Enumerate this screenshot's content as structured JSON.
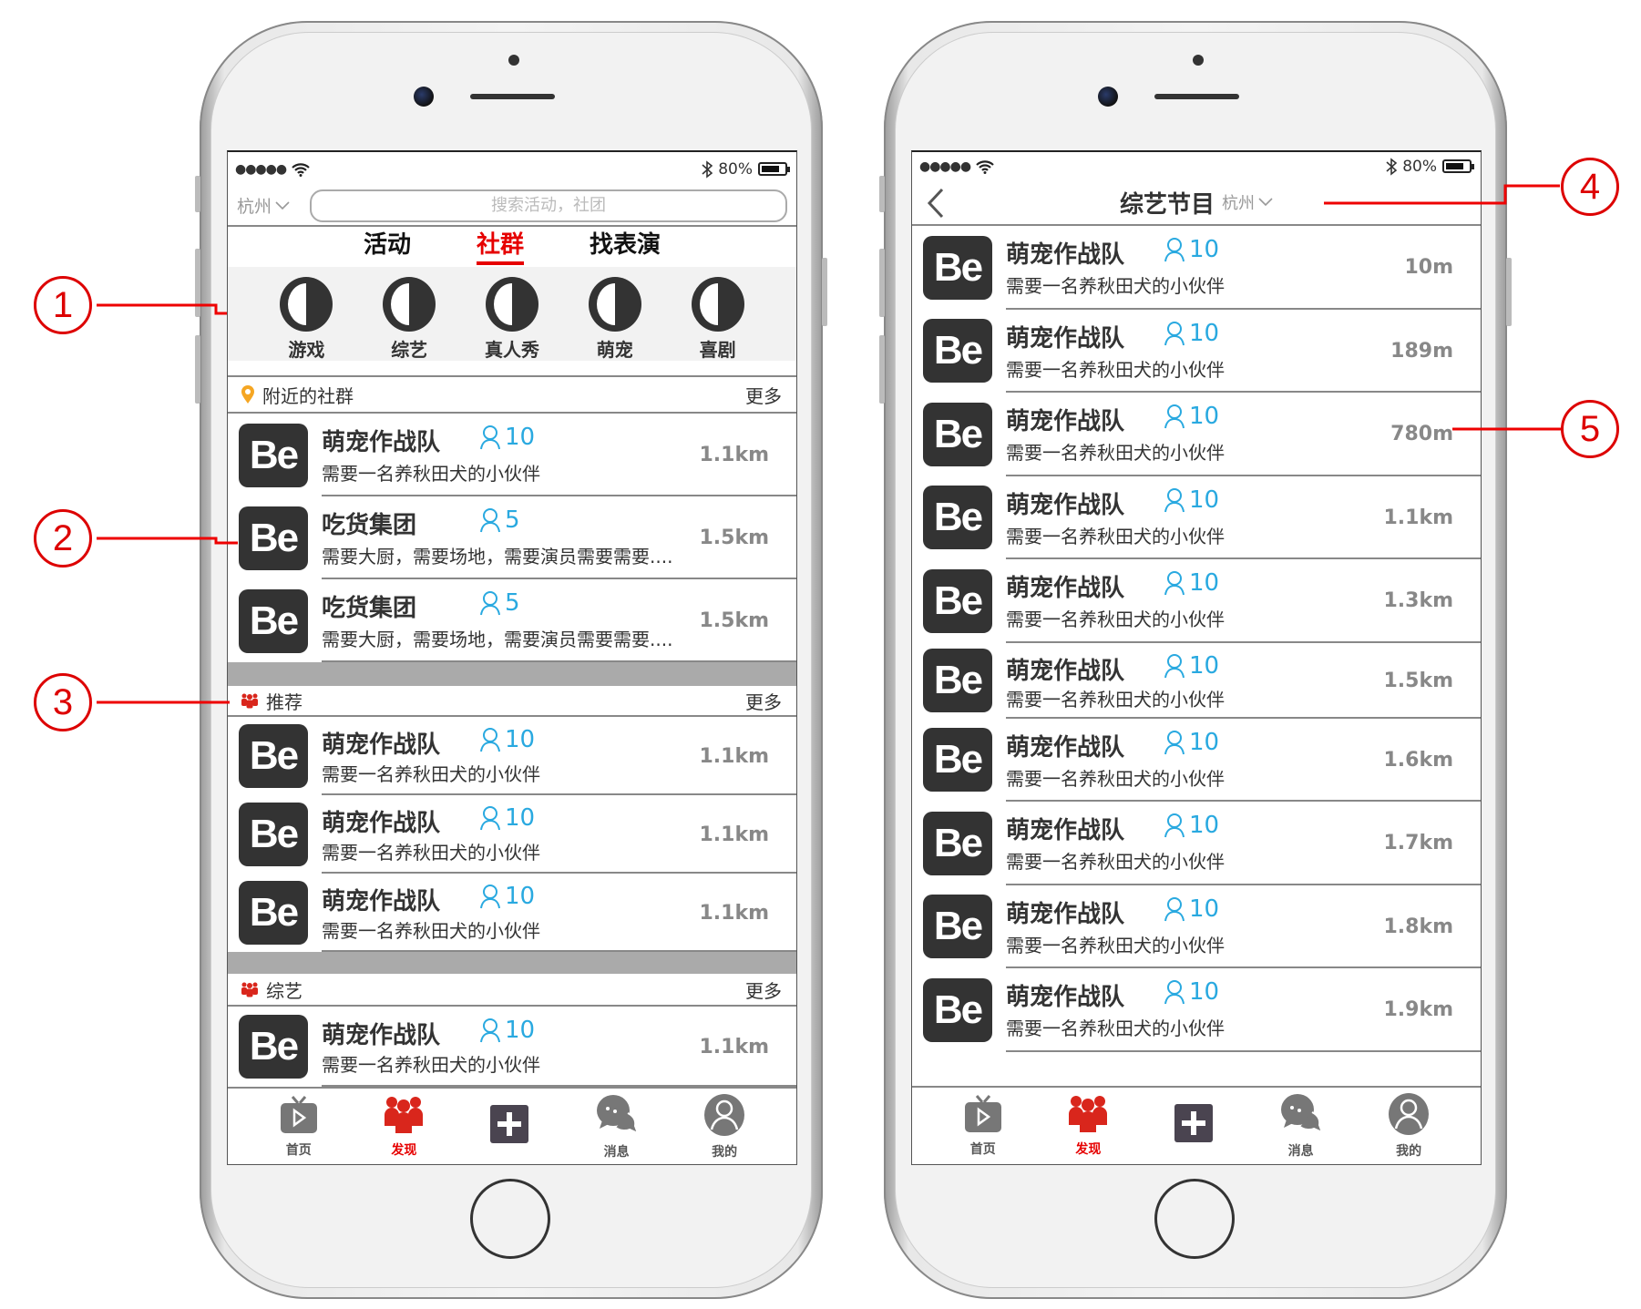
{
  "status": {
    "battery_pct": "80%",
    "battery_level": 0.8
  },
  "left": {
    "city": "杭州",
    "search_placeholder": "搜索活动，社团",
    "tabs": [
      {
        "label": "活动",
        "active": false
      },
      {
        "label": "社群",
        "active": true
      },
      {
        "label": "找表演",
        "active": false
      }
    ],
    "categories": [
      "游戏",
      "综艺",
      "真人秀",
      "萌宠",
      "喜剧"
    ],
    "sections": [
      {
        "title": "附近的社群",
        "more": "更多",
        "icon": "location-pin-icon",
        "rows": [
          {
            "avatar": "Be",
            "title": "萌宠作战队",
            "members": "10",
            "desc": "需要一名养秋田犬的小伙伴",
            "distance": "1.1km"
          },
          {
            "avatar": "Be",
            "title": "吃货集团",
            "members": "5",
            "desc": "需要大厨，需要场地，需要演员需要需要....",
            "distance": "1.5km"
          },
          {
            "avatar": "Be",
            "title": "吃货集团",
            "members": "5",
            "desc": "需要大厨，需要场地，需要演员需要需要....",
            "distance": "1.5km"
          }
        ]
      },
      {
        "title": "推荐",
        "more": "更多",
        "icon": "group-icon",
        "rows": [
          {
            "avatar": "Be",
            "title": "萌宠作战队",
            "members": "10",
            "desc": "需要一名养秋田犬的小伙伴",
            "distance": "1.1km"
          },
          {
            "avatar": "Be",
            "title": "萌宠作战队",
            "members": "10",
            "desc": "需要一名养秋田犬的小伙伴",
            "distance": "1.1km"
          },
          {
            "avatar": "Be",
            "title": "萌宠作战队",
            "members": "10",
            "desc": "需要一名养秋田犬的小伙伴",
            "distance": "1.1km"
          }
        ]
      },
      {
        "title": "综艺",
        "more": "更多",
        "icon": "group-icon",
        "rows": [
          {
            "avatar": "Be",
            "title": "萌宠作战队",
            "members": "10",
            "desc": "需要一名养秋田犬的小伙伴",
            "distance": "1.1km"
          }
        ]
      }
    ]
  },
  "right": {
    "title": "综艺节目",
    "city": "杭州",
    "rows": [
      {
        "avatar": "Be",
        "title": "萌宠作战队",
        "members": "10",
        "desc": "需要一名养秋田犬的小伙伴",
        "distance": "10m"
      },
      {
        "avatar": "Be",
        "title": "萌宠作战队",
        "members": "10",
        "desc": "需要一名养秋田犬的小伙伴",
        "distance": "189m"
      },
      {
        "avatar": "Be",
        "title": "萌宠作战队",
        "members": "10",
        "desc": "需要一名养秋田犬的小伙伴",
        "distance": "780m"
      },
      {
        "avatar": "Be",
        "title": "萌宠作战队",
        "members": "10",
        "desc": "需要一名养秋田犬的小伙伴",
        "distance": "1.1km"
      },
      {
        "avatar": "Be",
        "title": "萌宠作战队",
        "members": "10",
        "desc": "需要一名养秋田犬的小伙伴",
        "distance": "1.3km"
      },
      {
        "avatar": "Be",
        "title": "萌宠作战队",
        "members": "10",
        "desc": "需要一名养秋田犬的小伙伴",
        "distance": "1.5km"
      },
      {
        "avatar": "Be",
        "title": "萌宠作战队",
        "members": "10",
        "desc": "需要一名养秋田犬的小伙伴",
        "distance": "1.6km"
      },
      {
        "avatar": "Be",
        "title": "萌宠作战队",
        "members": "10",
        "desc": "需要一名养秋田犬的小伙伴",
        "distance": "1.7km"
      },
      {
        "avatar": "Be",
        "title": "萌宠作战队",
        "members": "10",
        "desc": "需要一名养秋田犬的小伙伴",
        "distance": "1.8km"
      },
      {
        "avatar": "Be",
        "title": "萌宠作战队",
        "members": "10",
        "desc": "需要一名养秋田犬的小伙伴",
        "distance": "1.9km"
      }
    ]
  },
  "tabbar": [
    {
      "label": "首页",
      "icon": "tv-play-icon",
      "active": false
    },
    {
      "label": "发现",
      "icon": "group-icon",
      "active": true
    },
    {
      "label": "",
      "icon": "plus-square-icon",
      "active": false
    },
    {
      "label": "消息",
      "icon": "chat-bubbles-icon",
      "active": false
    },
    {
      "label": "我的",
      "icon": "user-circle-icon",
      "active": false
    }
  ],
  "annotations": [
    "1",
    "2",
    "3",
    "4",
    "5"
  ],
  "colors": {
    "accent": "#e60000",
    "member_blue": "#29a9e0",
    "annotation": "#dd0000",
    "avatar_bg": "#333333"
  }
}
